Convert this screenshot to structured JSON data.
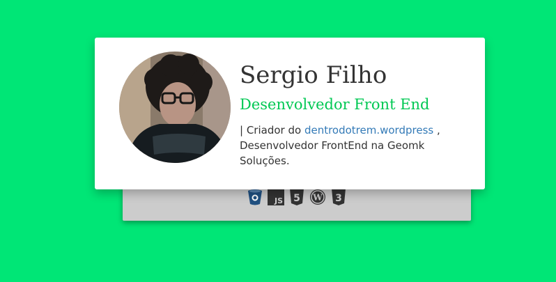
{
  "profile": {
    "name": "Sergio Filho",
    "role": "Desenvolvedor Front End",
    "bio": {
      "prefix": "| Criador do",
      "link_text": "dentrodotrem.wordpress",
      "suffix": ", Desenvolvedor FrontEnd na Geomk Soluções."
    }
  },
  "tech_icons": [
    "bitbucket-icon",
    "javascript-icon",
    "html5-icon",
    "wordpress-icon",
    "css3-icon"
  ],
  "colors": {
    "background": "#00e676",
    "accent": "#00c853",
    "link": "#337ab7",
    "icon_bar": "#cccccc"
  }
}
